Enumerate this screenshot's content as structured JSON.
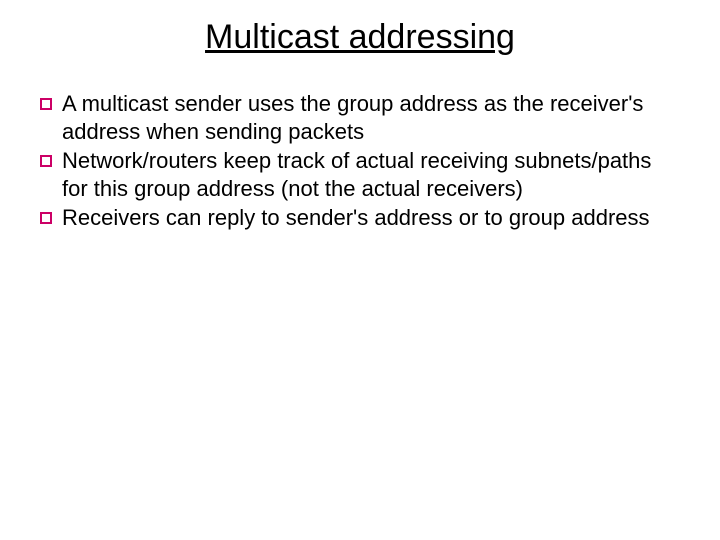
{
  "title": "Multicast addressing",
  "bullets": [
    "A multicast sender uses the group address as the receiver's address when sending packets",
    "Network/routers keep track of actual receiving subnets/paths for this group address (not the actual receivers)",
    "Receivers can reply to sender's address or to group address"
  ]
}
